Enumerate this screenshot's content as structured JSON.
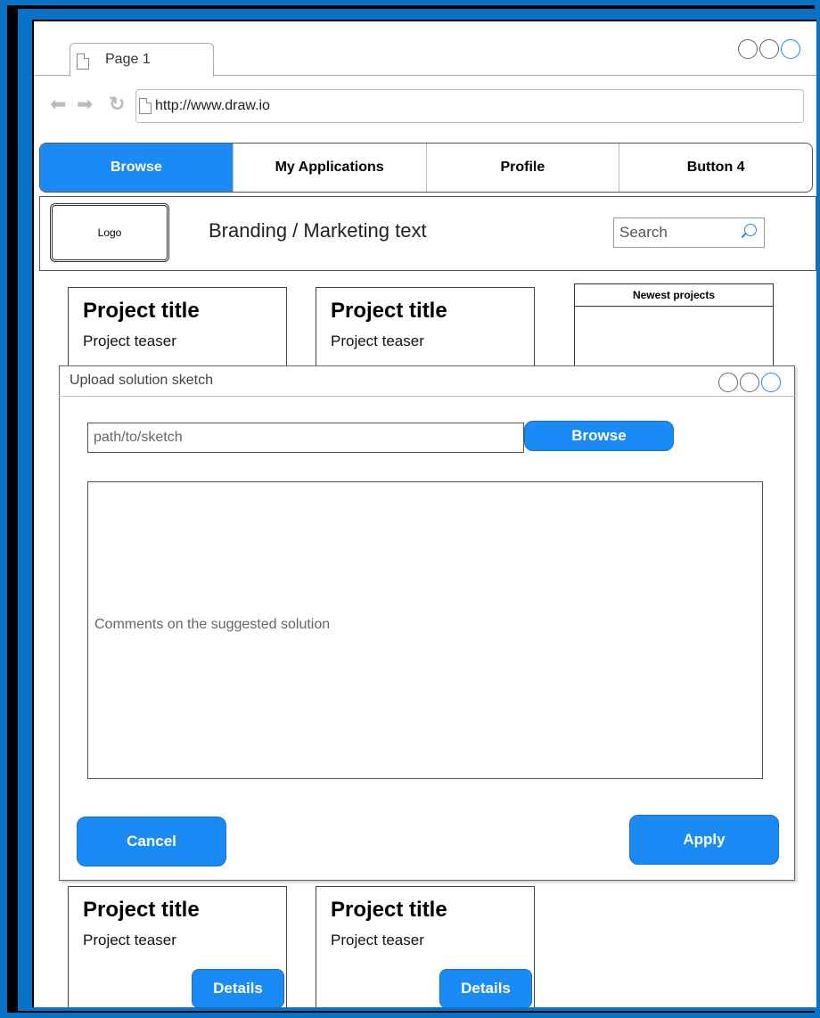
{
  "browser": {
    "tab_label": "Page 1",
    "url": "http://www.draw.io"
  },
  "menu": {
    "items": [
      {
        "label": "Browse",
        "active": true
      },
      {
        "label": "My Applications",
        "active": false
      },
      {
        "label": "Profile",
        "active": false
      },
      {
        "label": "Button 4",
        "active": false
      }
    ]
  },
  "header": {
    "logo": "Logo",
    "branding": "Branding / Marketing text",
    "search_placeholder": "Search"
  },
  "projects": [
    {
      "title": "Project title",
      "teaser": "Project teaser"
    },
    {
      "title": "Project title",
      "teaser": "Project teaser"
    },
    {
      "title": "Project title",
      "teaser": "Project teaser",
      "details_label": "Details"
    },
    {
      "title": "Project title",
      "teaser": "Project teaser",
      "details_label": "Details"
    }
  ],
  "sidebar": {
    "newest_title": "Newest projects"
  },
  "dialog": {
    "title": "Upload solution sketch",
    "path_placeholder": "path/to/sketch",
    "browse_label": "Browse",
    "comments_placeholder": "Comments on the suggested solution",
    "cancel_label": "Cancel",
    "apply_label": "Apply"
  },
  "colors": {
    "frame": "#0a72c4",
    "accent": "#1a8af5"
  }
}
